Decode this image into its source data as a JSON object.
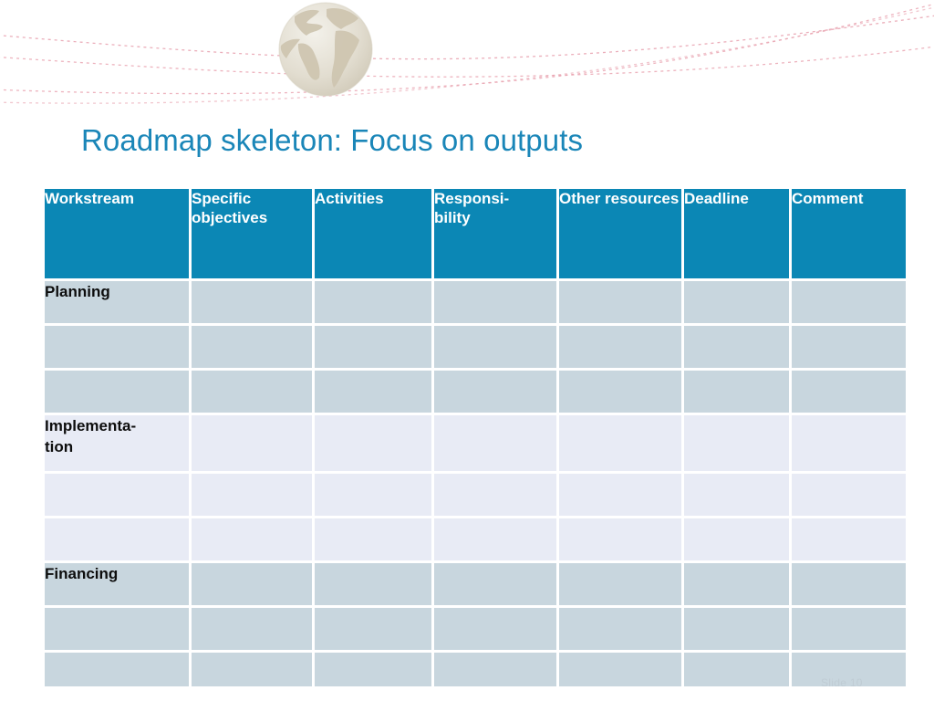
{
  "slide": {
    "title": "Roadmap skeleton: Focus on outputs",
    "slide_number_text": "Slide 10",
    "title_color": "#1a86b8",
    "header_fill": "#0b87b5",
    "row_fill_dark": "#c8d6de",
    "row_fill_light": "#e8ebf5",
    "gridline_color": "#ffffff",
    "background": "#ffffff"
  },
  "decor": {
    "globe_icon": "globe-watermark-icon",
    "globe_color": "#d8d3c4",
    "curve_color": "#e8a0ae"
  },
  "table": {
    "columns": [
      "Workstream",
      "Specific objectives",
      "Activities",
      "Responsi-\nbility",
      "Other resources",
      "Deadline",
      "Comment"
    ],
    "rows": [
      {
        "workstream": "Planning",
        "group": "dark",
        "cells": [
          "",
          "",
          "",
          "",
          "",
          ""
        ]
      },
      {
        "workstream": "",
        "group": "dark",
        "cells": [
          "",
          "",
          "",
          "",
          "",
          ""
        ]
      },
      {
        "workstream": "",
        "group": "dark",
        "cells": [
          "",
          "",
          "",
          "",
          "",
          ""
        ]
      },
      {
        "workstream": "Implementa-\ntion",
        "group": "light",
        "cells": [
          "",
          "",
          "",
          "",
          "",
          ""
        ]
      },
      {
        "workstream": "",
        "group": "light",
        "cells": [
          "",
          "",
          "",
          "",
          "",
          ""
        ]
      },
      {
        "workstream": "",
        "group": "light",
        "cells": [
          "",
          "",
          "",
          "",
          "",
          ""
        ]
      },
      {
        "workstream": "Financing",
        "group": "dark",
        "cells": [
          "",
          "",
          "",
          "",
          "",
          ""
        ]
      },
      {
        "workstream": "",
        "group": "dark",
        "cells": [
          "",
          "",
          "",
          "",
          "",
          ""
        ]
      },
      {
        "workstream": "",
        "group": "dark",
        "cells": [
          "",
          "",
          "",
          "",
          "",
          ""
        ]
      }
    ]
  }
}
